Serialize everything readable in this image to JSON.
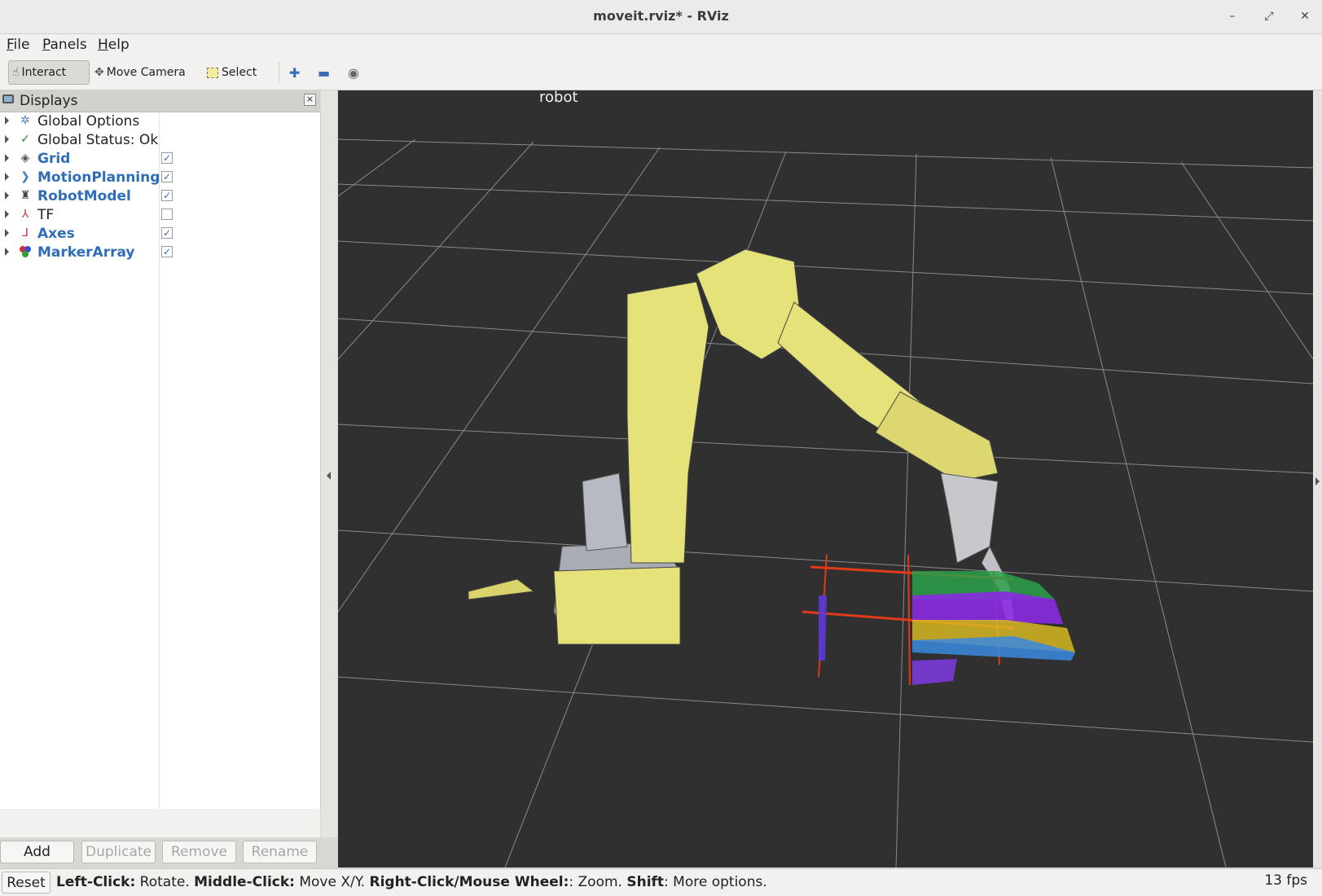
{
  "window": {
    "title": "moveit.rviz* - RViz"
  },
  "menu": [
    "File",
    "Panels",
    "Help"
  ],
  "toolbar": {
    "interact": "Interact",
    "move_camera": "Move Camera",
    "select": "Select"
  },
  "displays_panel": {
    "title": "Displays",
    "items": [
      {
        "label": "Global Options",
        "icon": "gear-icon",
        "style": "normal"
      },
      {
        "label": "Global Status: Ok",
        "icon": "checkmark-icon",
        "style": "normal"
      },
      {
        "label": "Grid",
        "icon": "grid-icon",
        "style": "blue",
        "checked": true
      },
      {
        "label": "MotionPlanning",
        "icon": "motion-planning-icon",
        "style": "blue",
        "checked": true
      },
      {
        "label": "RobotModel",
        "icon": "robot-icon",
        "style": "blue",
        "checked": true
      },
      {
        "label": "TF",
        "icon": "tf-axes-icon",
        "style": "normal",
        "checked": false
      },
      {
        "label": "Axes",
        "icon": "axes-icon",
        "style": "blue",
        "checked": true
      },
      {
        "label": "MarkerArray",
        "icon": "marker-array-icon",
        "style": "blue",
        "checked": true
      }
    ],
    "buttons": {
      "add": "Add",
      "duplicate": "Duplicate",
      "remove": "Remove",
      "rename": "Rename"
    }
  },
  "viewport": {
    "label": "robot"
  },
  "status": {
    "reset": "Reset",
    "left_key": "Left-Click:",
    "left_text": " Rotate. ",
    "middle_key": "Middle-Click:",
    "middle_text": " Move X/Y. ",
    "right_key": "Right-Click/Mouse Wheel:",
    "right_text": ": Zoom. ",
    "shift_key": "Shift",
    "shift_text": ": More options.",
    "fps": "13 fps"
  },
  "colors": {
    "viewport_bg": "#303030",
    "robot": "#e6e27a",
    "accent_blue": "#2f6db8"
  }
}
